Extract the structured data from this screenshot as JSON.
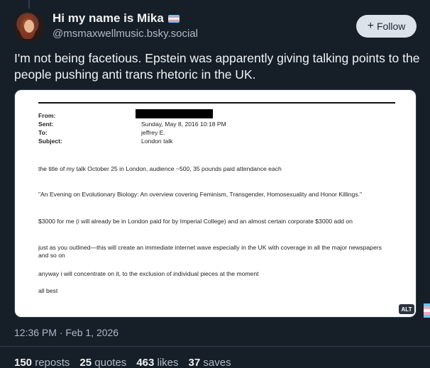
{
  "author": {
    "display_name": "Hi my name is Mika",
    "flag_icon": "transgender-flag-icon",
    "handle": "@msmaxwellmusic.bsky.social"
  },
  "follow_button": {
    "label": "Follow",
    "icon": "plus-icon"
  },
  "post": {
    "text": "I'm not being facetious. Epstein was apparently giving talking points to the people pushing anti trans rhetoric in the UK.",
    "timestamp": "12:36 PM · Feb 1, 2026"
  },
  "image": {
    "alt_badge": "ALT",
    "email": {
      "headers": [
        {
          "label": "From:",
          "value": ""
        },
        {
          "label": "Sent:",
          "value": "Sunday, May 8, 2016 10:18 PM"
        },
        {
          "label": "To:",
          "value": "jeffrey E."
        },
        {
          "label": "Subject:",
          "value": "London talk"
        }
      ],
      "body": [
        "the title of my talk October 25 in London, audience ~500, 35 pounds paid attendance each",
        "\"An Evening on Evolutionary Biology: An overview covering Feminism, Transgender, Homosexuality and Honor Killings.\"",
        "$3000 for me (i will already be in London paid for by Imperial College) and an almost certain corporate $3000 add on",
        "just as you outlined—this will create an immediate internet wave especially in the UK with coverage in all the major newspapers and so on",
        "anyway i will concentrate on it, to the exclusion of individual pieces at the moment",
        "all best"
      ]
    }
  },
  "stats": [
    {
      "count": "150",
      "label": "reposts"
    },
    {
      "count": "25",
      "label": "quotes"
    },
    {
      "count": "463",
      "label": "likes"
    },
    {
      "count": "37",
      "label": "saves"
    }
  ],
  "colors": {
    "background": "#161e27",
    "muted_text": "#aebbc9",
    "follow_bg": "#dce2ea"
  }
}
